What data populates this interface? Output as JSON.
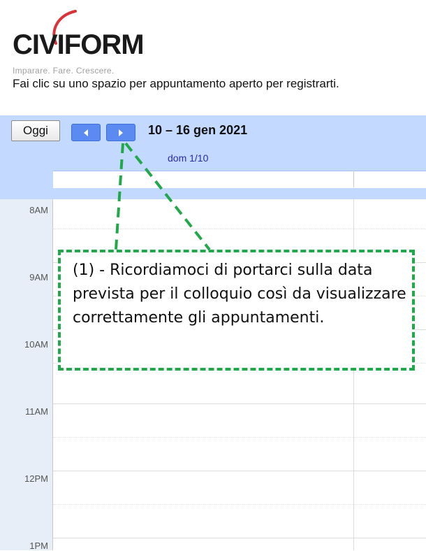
{
  "brand": {
    "logo_text": "CIVIFORM",
    "tagline": "Imparare.  Fare.  Crescere."
  },
  "instruction": "Fai clic su uno spazio per appuntamento aperto per registrarti.",
  "toolbar": {
    "today_label": "Oggi",
    "prev_icon": "chevron-left-icon",
    "next_icon": "chevron-right-icon",
    "date_range": "10 – 16 gen 2021"
  },
  "calendar": {
    "day_columns": [
      {
        "label": "dom 1/10"
      }
    ],
    "hours": [
      "8AM",
      "9AM",
      "10AM",
      "11AM",
      "12PM",
      "1PM"
    ]
  },
  "annotation": {
    "text": "(1) - Ricordiamoci di portarci sulla data prevista per il colloquio così da visualizzare correttamente gli appuntamenti.",
    "border_color": "#22a84a"
  },
  "colors": {
    "toolbar_bg": "#c3d9ff",
    "nav_button": "#5b8bf0",
    "logo_accent": "#d9343a",
    "day_label": "#2a2aa8"
  }
}
